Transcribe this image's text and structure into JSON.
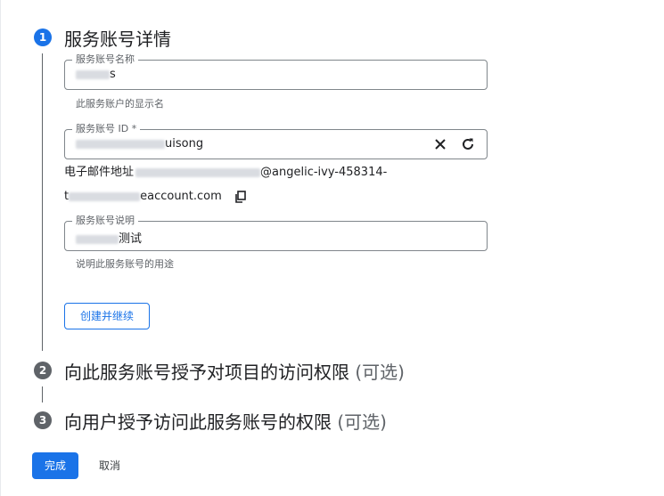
{
  "steps": [
    {
      "number": "1",
      "title": "服务账号详情",
      "optional": ""
    },
    {
      "number": "2",
      "title": "向此服务账号授予对项目的访问权限",
      "optional": "(可选)"
    },
    {
      "number": "3",
      "title": "向用户授予访问此服务账号的权限",
      "optional": "(可选)"
    }
  ],
  "form": {
    "name": {
      "label": "服务账号名称",
      "value_visible": "s",
      "hint": "此服务账户的显示名"
    },
    "account_id": {
      "label": "服务账号 ID *",
      "value_visible": "uisong"
    },
    "email": {
      "label": "电子邮件地址",
      "domain_part1": "@angelic-ivy-458314-",
      "line2_prefix": "t",
      "line2_suffix": "eaccount.com"
    },
    "description": {
      "label": "服务账号说明",
      "value_visible": "测试",
      "hint": "说明此服务账号的用途"
    }
  },
  "buttons": {
    "create_continue": "创建并继续",
    "done": "完成",
    "cancel": "取消"
  },
  "colors": {
    "accent": "#1a73e8",
    "step_inactive": "#5f6368"
  },
  "icons": {
    "clear": "close-icon",
    "regenerate": "refresh-icon",
    "copy": "copy-icon"
  }
}
